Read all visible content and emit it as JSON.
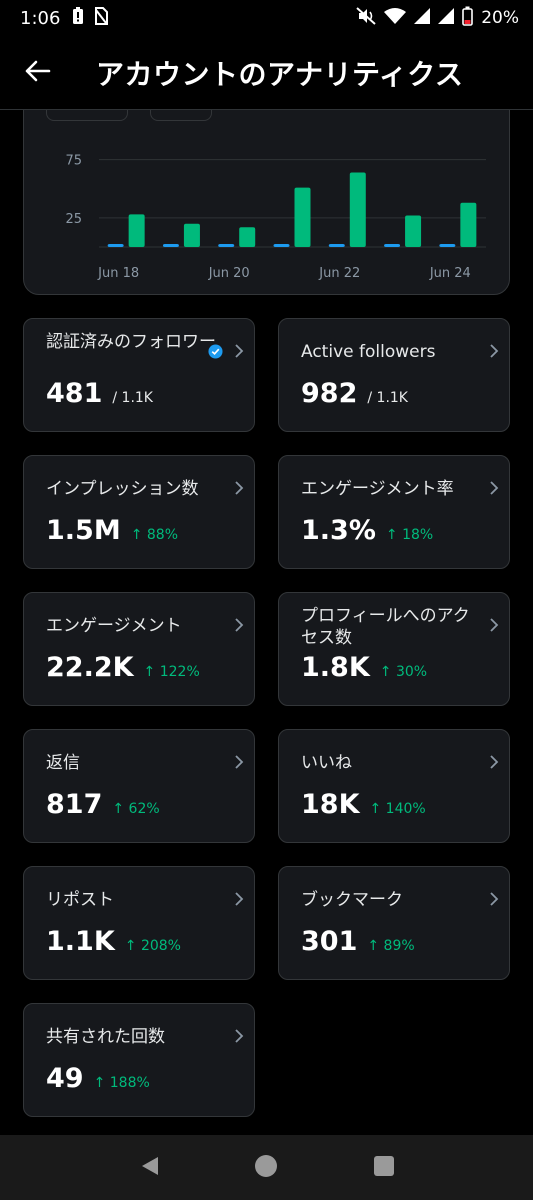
{
  "status_bar": {
    "time": "1:06",
    "battery": "20%",
    "icons": [
      "alert-icon",
      "no-sim-icon",
      "mute-icon",
      "wifi-icon",
      "signal-icon",
      "signal-icon",
      "battery-icon"
    ]
  },
  "header": {
    "title": "アカウントのアナリティクス",
    "back_icon": "back-arrow-icon"
  },
  "chart_data": {
    "type": "bar",
    "categories": [
      "Jun 18",
      "Jun 19",
      "Jun 20",
      "Jun 21",
      "Jun 22",
      "Jun 23",
      "Jun 24"
    ],
    "x_tick_labels": [
      "Jun 18",
      "Jun 20",
      "Jun 22",
      "Jun 24"
    ],
    "y_tick_labels": [
      "75",
      "25"
    ],
    "ylim": [
      0,
      100
    ],
    "grid": true,
    "series": [
      {
        "color": "#1d9bf0",
        "values": [
          1,
          1,
          1,
          1,
          1,
          1,
          2
        ]
      },
      {
        "color": "#00ba7c",
        "values": [
          28,
          20,
          17,
          51,
          64,
          27,
          38
        ]
      }
    ]
  },
  "metrics": [
    {
      "label": "認証済みのフォロワー",
      "value": "481",
      "sub": "/ 1.1K",
      "verified": true
    },
    {
      "label": "Active followers",
      "value": "982",
      "sub": "/ 1.1K"
    },
    {
      "label": "インプレッション数",
      "value": "1.5M",
      "delta": "↑ 88%"
    },
    {
      "label": "エンゲージメント率",
      "value": "1.3%",
      "delta": "↑ 18%"
    },
    {
      "label": "エンゲージメント",
      "value": "22.2K",
      "delta": "↑ 122%"
    },
    {
      "label": "プロフィールへのアクセス数",
      "value": "1.8K",
      "delta": "↑ 30%"
    },
    {
      "label": "返信",
      "value": "817",
      "delta": "↑ 62%"
    },
    {
      "label": "いいね",
      "value": "18K",
      "delta": "↑ 140%"
    },
    {
      "label": "リポスト",
      "value": "1.1K",
      "delta": "↑ 208%"
    },
    {
      "label": "ブックマーク",
      "value": "301",
      "delta": "↑ 89%"
    },
    {
      "label": "共有された回数",
      "value": "49",
      "delta": "↑ 188%"
    }
  ],
  "colors": {
    "accent_blue": "#1d9bf0",
    "accent_green": "#00ba7c",
    "card_bg": "#16181c",
    "border": "#333639"
  },
  "nav_bar": {
    "buttons": [
      "back-triangle-icon",
      "home-circle-icon",
      "recents-square-icon"
    ]
  }
}
